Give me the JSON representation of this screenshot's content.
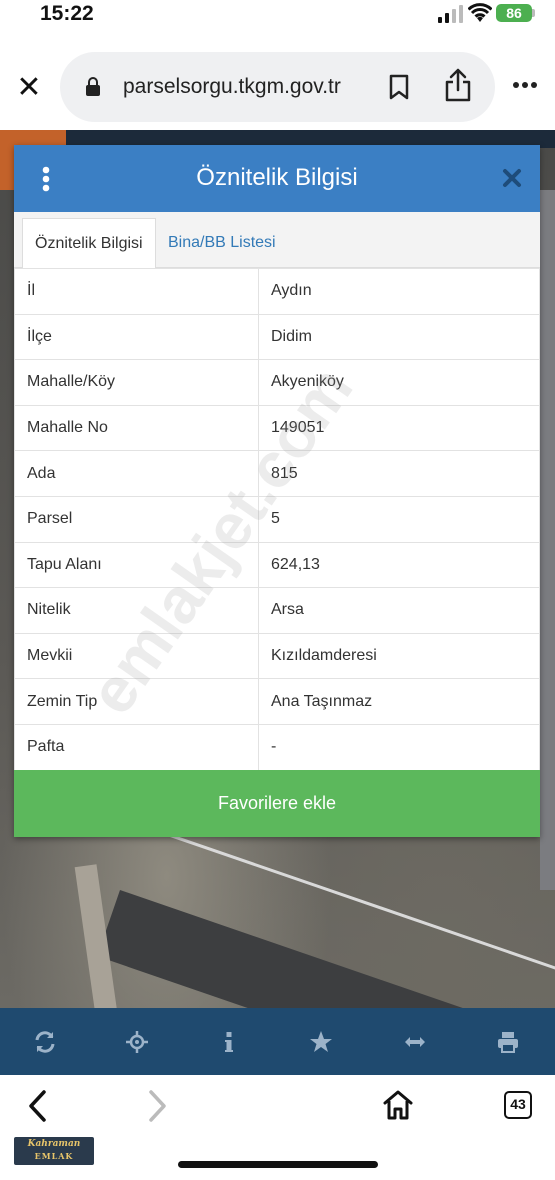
{
  "status_bar": {
    "time": "15:22",
    "battery": "86"
  },
  "browser": {
    "url": "parselsorgu.tkgm.gov.tr",
    "tab_count": "43"
  },
  "dialog": {
    "title": "Öznitelik Bilgisi",
    "tabs": [
      {
        "label": "Öznitelik Bilgisi",
        "active": true
      },
      {
        "label": "Bina/BB Listesi",
        "active": false
      }
    ],
    "rows": [
      {
        "key": "İl",
        "value": "Aydın"
      },
      {
        "key": "İlçe",
        "value": "Didim"
      },
      {
        "key": "Mahalle/Köy",
        "value": "Akyeniköy"
      },
      {
        "key": "Mahalle No",
        "value": "149051"
      },
      {
        "key": "Ada",
        "value": "815"
      },
      {
        "key": "Parsel",
        "value": "5"
      },
      {
        "key": "Tapu Alanı",
        "value": "624,13"
      },
      {
        "key": "Nitelik",
        "value": "Arsa"
      },
      {
        "key": "Mevkii",
        "value": "Kızıldamderesi"
      },
      {
        "key": "Zemin Tip",
        "value": "Ana Taşınmaz"
      },
      {
        "key": "Pafta",
        "value": "-"
      }
    ],
    "favorite_button": "Favorilere ekle"
  },
  "watermark": "emlakjet.com",
  "logo": {
    "top": "Kahraman",
    "bottom": "EMLAK"
  },
  "map_toolbar": [
    "refresh-icon",
    "locate-icon",
    "info-icon",
    "star-icon",
    "measure-icon",
    "print-icon"
  ],
  "colors": {
    "header": "#3b7fc4",
    "button": "#5cb85c",
    "toolbar": "#1f4a6f",
    "battery": "#4caf50"
  }
}
